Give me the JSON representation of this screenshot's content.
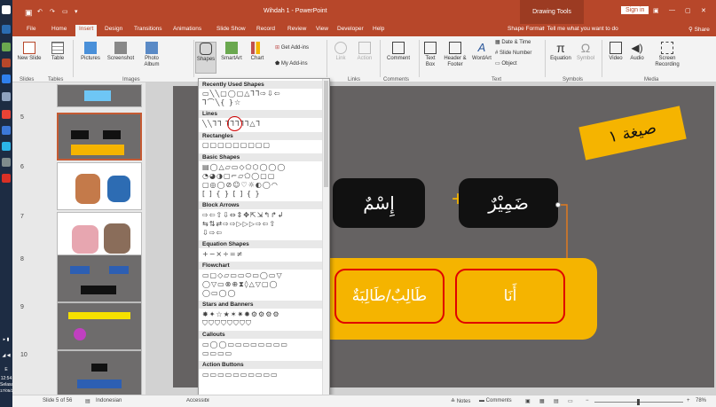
{
  "window": {
    "title": "Wihdah 1 - PowerPoint",
    "context_tab": "Drawing Tools",
    "sign_in": "Sign in"
  },
  "tabs": [
    "File",
    "Home",
    "Insert",
    "Design",
    "Transitions",
    "Animations",
    "Slide Show",
    "Record",
    "Review",
    "View",
    "Developer",
    "Help",
    "Shape Format"
  ],
  "tell_me": "Tell me what you want to do",
  "share": "Share",
  "ribbon": {
    "new_slide": "New Slide",
    "table": "Table",
    "pictures": "Pictures",
    "screenshot": "Screenshot",
    "photo_album": "Photo Album",
    "shapes": "Shapes",
    "smartart": "SmartArt",
    "chart": "Chart",
    "get_addins": "Get Add-ins",
    "my_addins": "My Add-ins",
    "link": "Link",
    "action": "Action",
    "comment": "Comment",
    "textbox": "Text Box",
    "header_footer": "Header & Footer",
    "wordart": "WordArt",
    "date_time": "Date & Time",
    "slide_number": "Slide Number",
    "object": "Object",
    "equation": "Equation",
    "symbol": "Symbol",
    "video": "Video",
    "audio": "Audio",
    "screen_recording": "Screen Recording",
    "groups": {
      "slides": "Slides",
      "tables": "Tables",
      "images": "Images",
      "links": "Links",
      "comments": "Comments",
      "text": "Text",
      "symbols": "Symbols",
      "media": "Media"
    }
  },
  "shapes_menu": {
    "sections": [
      "Recently Used Shapes",
      "Lines",
      "Rectangles",
      "Basic Shapes",
      "Block Arrows",
      "Equation Shapes",
      "Flowchart",
      "Stars and Banners",
      "Callouts",
      "Action Buttons"
    ],
    "rows": {
      "recent1": "▭╲╲▢◯▢△⅂⅂⇨⇩⇦",
      "recent2": "⅂⌒╲{ }☆",
      "lines": "╲╲⅂⅂ ⅂⅂⅂⅂⅂△⅂",
      "rect": "▢▢▢▢▢▢▢▢▢",
      "basic1": "▤◯△▱▭◇⬠⬡◯◯◯",
      "basic2": "◔◕◑▢⌐▱⬠◯▢▢",
      "basic3": "▢◎◯⊘☺♡☼◐◯◠",
      "basic4": "[ ] { } [ ] { }",
      "arrows1": "⇨⇦⇧⇩⇔⇕✥⇱⇲↰↱↲",
      "arrows2": "⇆⇅⇄⇨⇨▷▷▷⇨⇦⇧",
      "arrows3": "⇩⇨⇦",
      "eq": "+−×÷=≠",
      "flow1": "▭▢◇▱▭▭⬭▭◯▭▽",
      "flow2": "◯▽▭⊗⊕⧗◊△▽▢◯",
      "flow3": "◯▭◯◯",
      "stars1": "✸✦☆★✶✷✹⚙⚙⚙⚙",
      "stars2": "⛉⛉⛉⛉⛉⛉⛉⛉",
      "callouts1": "▭◯◯▭▭▭▭▭▭▭▭",
      "callouts2": "▭▭▭▭",
      "action": "▭▭▭▭▭▭▭▭▭▭"
    }
  },
  "slide": {
    "title_badge": "صيغة ١",
    "isim": "إِسْمٌ",
    "plus": "+",
    "dhamir": "ضَمِيْرٌ",
    "talib": "طَالِبٌ/طَالِبَةٌ",
    "ana": "أَنَا"
  },
  "thumbs": [
    "5",
    "6",
    "7",
    "8",
    "9",
    "10"
  ],
  "status": {
    "slide_of": "Slide 5 of 56",
    "language": "Indonesian",
    "accessibility": "Accessibility: Investigate",
    "notes": "Notes",
    "comments": "Comments",
    "zoom": "78%"
  },
  "clock": {
    "time": "12:54",
    "day": "Selasa",
    "date": "17/05/2022"
  },
  "colors": {
    "accent": "#b7472a",
    "slide_bg": "#656262",
    "yellow": "#f5b400",
    "red": "#e00000"
  }
}
